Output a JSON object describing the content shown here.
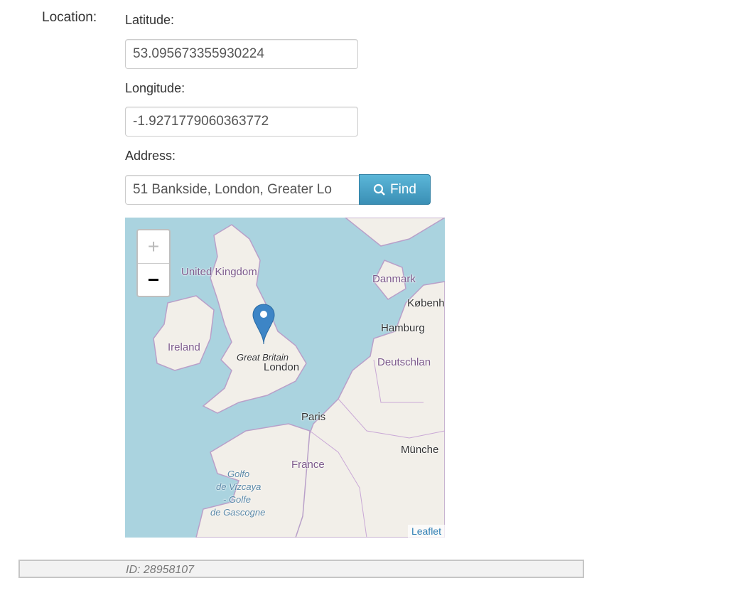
{
  "location_label": "Location:",
  "latitude": {
    "label": "Latitude:",
    "value": "53.095673355930224"
  },
  "longitude": {
    "label": "Longitude:",
    "value": "-1.9271779060363772"
  },
  "address": {
    "label": "Address:",
    "value": "51 Bankside, London, Greater Lo",
    "find_label": "Find"
  },
  "map": {
    "zoom_in": "+",
    "zoom_out": "−",
    "attribution": "Leaflet",
    "labels": {
      "uk": "United Kingdom",
      "denmark": "Danmark",
      "kobenhavn": "Københ",
      "hamburg": "Hamburg",
      "ireland": "Ireland",
      "great_britain": "Great Britain",
      "london": "London",
      "deutschland": "Deutschlan",
      "paris": "Paris",
      "munchen": "Münche",
      "france": "France",
      "golfo1": "Golfo",
      "golfo2": "de Vizcaya",
      "golfo3": "- Golfe",
      "golfo4": "de Gascogne"
    },
    "marker_color": "#3d85c6"
  },
  "footer": {
    "id_text": "ID: 28958107"
  }
}
